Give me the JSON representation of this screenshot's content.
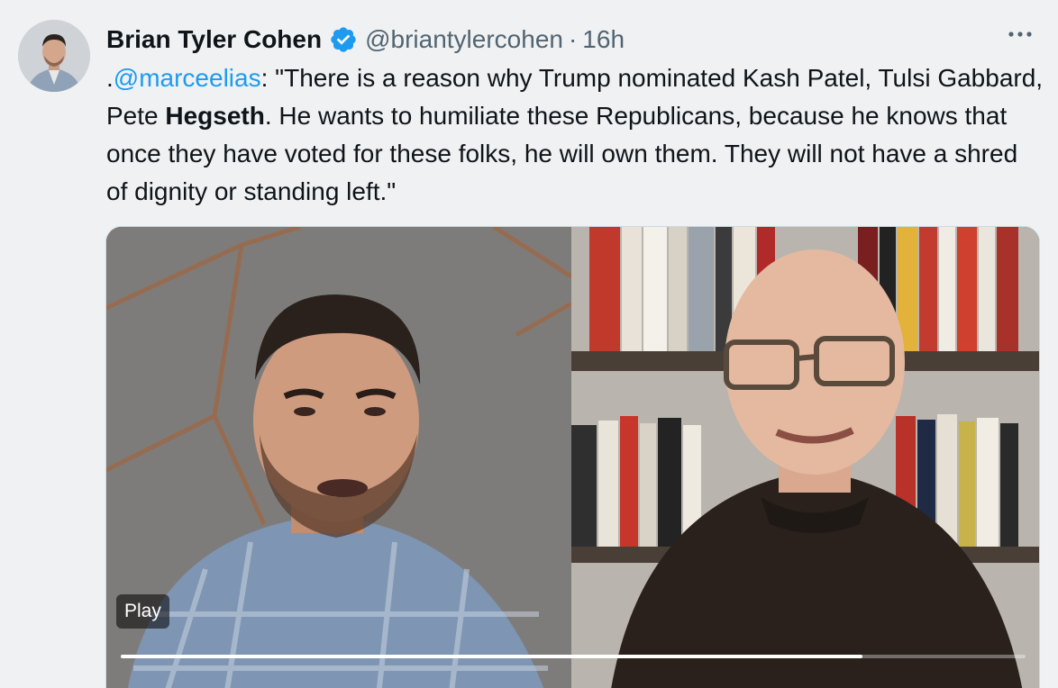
{
  "tweet": {
    "author_name": "Brian Tyler Cohen",
    "handle": "@briantylercohen",
    "separator": "·",
    "time": "16h",
    "text": {
      "prefix": ".",
      "mention": "@marceelias",
      "part1": ": \"There is a reason why Trump nominated Kash Patel, Tulsi Gabbard, Pete ",
      "bold": "Hegseth",
      "part2": ". He wants to humiliate these Republicans, because he knows that once they have voted for these folks, he will own them. They will not have a shred of dignity or standing left.\""
    }
  },
  "media": {
    "play_label": "Play",
    "progress_fraction": 0.82
  },
  "icons": {
    "verified": "verified-badge-icon",
    "more": "more-horizontal-icon"
  },
  "colors": {
    "background": "#eff1f3",
    "link": "#1d9bf0",
    "secondary_text": "#536471",
    "verified": "#1d9bf0"
  }
}
